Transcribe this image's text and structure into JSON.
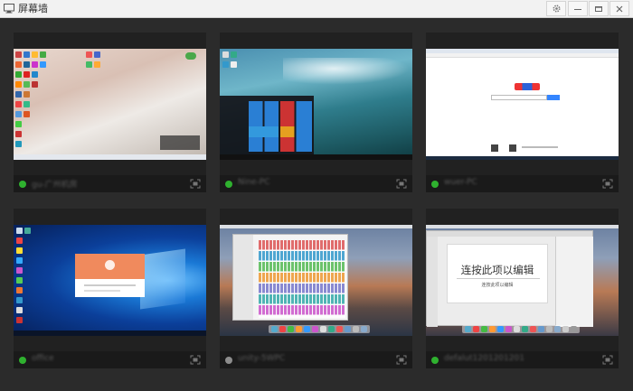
{
  "window": {
    "title": "屏幕墙",
    "controls": [
      {
        "name": "settings-button",
        "icon": "gear-icon"
      },
      {
        "name": "minimize-button",
        "icon": "minimize-icon"
      },
      {
        "name": "maximize-button",
        "icon": "maximize-icon"
      },
      {
        "name": "close-button",
        "icon": "close-icon"
      }
    ]
  },
  "devices": [
    {
      "name": "gu-广州机房",
      "status": "online",
      "screen": "windows-desktop-bed"
    },
    {
      "name": "Nine-PC",
      "status": "online",
      "screen": "windows10-start-menu-wave"
    },
    {
      "name": "wuer-PC",
      "status": "online",
      "screen": "browser-baidu"
    },
    {
      "name": "office",
      "status": "online",
      "screen": "windows10-dialog"
    },
    {
      "name": "unity-5WPC",
      "status": "offline",
      "screen": "mac-launchpad"
    },
    {
      "name": "defalut1201201201",
      "status": "online",
      "screen": "mac-keynote"
    }
  ],
  "keynote": {
    "title_placeholder": "连按此项以编辑",
    "subtitle_placeholder": "连按此项以编辑"
  },
  "colors": {
    "online": "#2fb12f",
    "offline": "#8d8d8d",
    "background": "#2b2b2b",
    "card": "#212121"
  }
}
